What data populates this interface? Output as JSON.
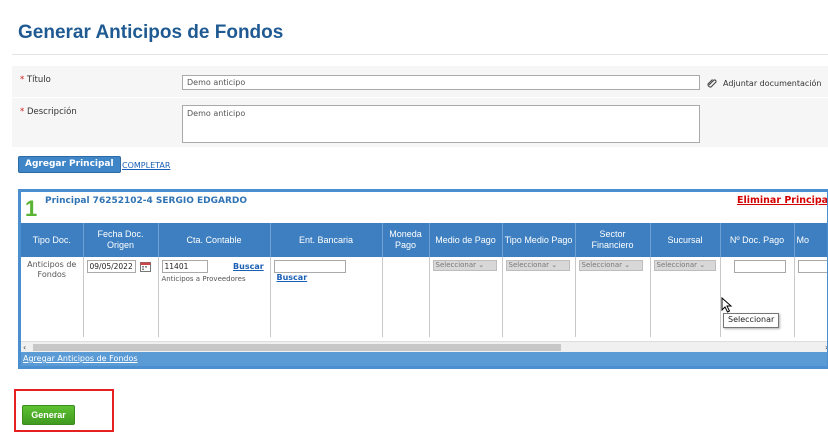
{
  "page": {
    "title": "Generar Anticipos de Fondos"
  },
  "form": {
    "titulo_label": "Título",
    "titulo_value": "Demo anticipo",
    "descripcion_label": "Descripción",
    "descripcion_value": "Demo anticipo",
    "required_mark": "*",
    "attach_label": "Adjuntar documentación",
    "attach_icon": "paperclip-icon"
  },
  "actions": {
    "agregar_principal": "Agregar Principal",
    "completar": "COMPLETAR",
    "generar": "Generar"
  },
  "principal": {
    "number": "1",
    "title": "Principal 76252102-4 SERGIO EDGARDO",
    "eliminar": "Eliminar Principal",
    "add_link": "Agregar Anticipos de Fondos",
    "columns": [
      "Tipo Doc.",
      "Fecha Doc. Origen",
      "Cta. Contable",
      "Ent. Bancaria",
      "Moneda Pago",
      "Medio de Pago",
      "Tipo Medio Pago",
      "Sector Financiero",
      "Sucursal",
      "Nº Doc. Pago",
      "Mo"
    ],
    "row": {
      "tipo_doc": "Anticipos de Fondos",
      "fecha": "09/05/2022",
      "cta_code": "11401",
      "cta_desc": "Anticipos a Proveedores",
      "buscar": "Buscar",
      "ent_bancaria_value": "",
      "select_placeholder": "Seleccionar"
    }
  },
  "tooltip": "Seleccionar",
  "colors": {
    "header_blue": "#3d7fc0",
    "title_blue": "#1f5a93",
    "green": "#4caf28",
    "red": "#e62020"
  }
}
